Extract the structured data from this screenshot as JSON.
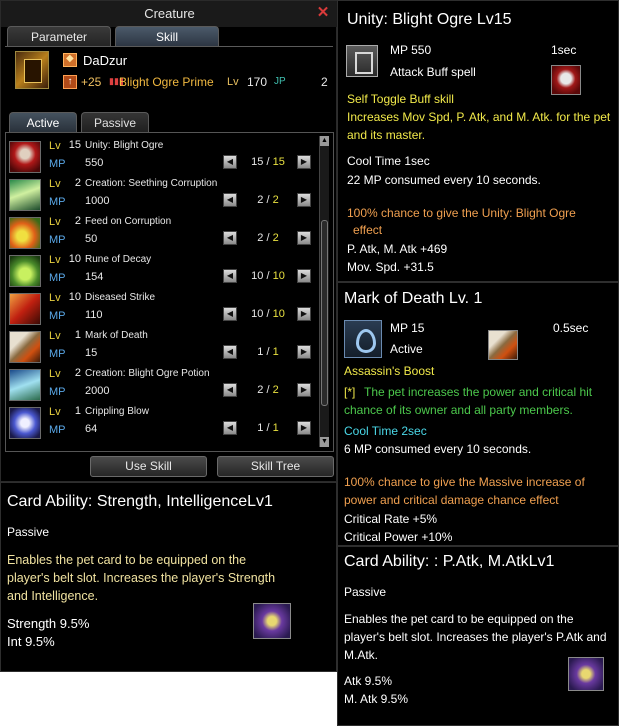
{
  "creature_window": {
    "title": "Creature",
    "close_symbol": "✕",
    "tabs": [
      {
        "label": "Parameter"
      },
      {
        "label": "Skill"
      }
    ],
    "pet": {
      "name": "DaDzur",
      "rank_plus": "+25",
      "species": "Blight Ogre Prime",
      "level_label": "Lv",
      "level": "170",
      "jp_label": "JP",
      "jp": "2"
    },
    "subtabs": [
      {
        "label": "Active"
      },
      {
        "label": "Passive"
      }
    ],
    "skill_level_label": "Lv",
    "skill_mp_label": "MP",
    "skills": [
      {
        "name": "Unity: Blight Ogre",
        "level": "15",
        "mp": "550",
        "current": "15",
        "max": "15",
        "icon": "blight-ogre-icon"
      },
      {
        "name": "Creation: Seething Corruption",
        "level": "2",
        "mp": "1000",
        "current": "2",
        "max": "2",
        "icon": "seething-corruption-icon"
      },
      {
        "name": "Feed on Corruption",
        "level": "2",
        "mp": "50",
        "current": "2",
        "max": "2",
        "icon": "feed-corruption-icon"
      },
      {
        "name": "Rune of Decay",
        "level": "10",
        "mp": "154",
        "current": "10",
        "max": "10",
        "icon": "rune-of-decay-icon"
      },
      {
        "name": "Diseased Strike",
        "level": "10",
        "mp": "110",
        "current": "10",
        "max": "10",
        "icon": "diseased-strike-icon"
      },
      {
        "name": "Mark of Death",
        "level": "1",
        "mp": "15",
        "current": "1",
        "max": "1",
        "icon": "mark-of-death-icon"
      },
      {
        "name": "Creation: Blight Ogre Potion",
        "level": "2",
        "mp": "2000",
        "current": "2",
        "max": "2",
        "icon": "ogre-potion-icon"
      },
      {
        "name": "Crippling Blow",
        "level": "1",
        "mp": "64",
        "current": "1",
        "max": "1",
        "icon": "crippling-blow-icon"
      }
    ],
    "buttons": {
      "use_skill": "Use Skill",
      "skill_tree": "Skill Tree"
    }
  },
  "tooltip_unity": {
    "title": "Unity: Blight Ogre Lv15",
    "mp": "MP 550",
    "cast_time": "1sec",
    "spell_type": "Attack Buff spell",
    "kind": "Self Toggle Buff skill",
    "description_line1": "Increases Mov Spd, P. Atk, and M. Atk. for the pet",
    "description_line2": "and its master.",
    "cooltime": "Cool Time 1sec",
    "consumption": "22 MP consumed every 10 seconds.",
    "chance_line1": "100% chance to give the Unity: Blight Ogre",
    "chance_line2": "effect",
    "effect1": "P. Atk, M. Atk +469",
    "effect2": "Mov. Spd. +31.5"
  },
  "tooltip_mark": {
    "title": "Mark of Death Lv. 1",
    "mp": "MP 15",
    "cast_time": "0.5sec",
    "kind": "Active",
    "boost": "Assassin's Boost",
    "marker": "[*]",
    "description_line1": "The pet increases the power and critical hit",
    "description_line2": "chance of its owner and all party members.",
    "cooltime": "Cool Time 2sec",
    "consumption": "6 MP consumed every 10 seconds.",
    "chance_line1": "100% chance to give the Massive increase of",
    "chance_line2": "power and critical damage chance effect",
    "effect1": "Critical Rate +5%",
    "effect2": "Critical Power +10%"
  },
  "tooltip_card1": {
    "title": "Card Ability: Strength, IntelligenceLv1",
    "kind": "Passive",
    "description_line1": "Enables the pet card to be equipped on the",
    "description_line2": "player's belt slot. Increases the player's Strength",
    "description_line3": "and Intelligence.",
    "effect1": "Strength 9.5%",
    "effect2": "Int 9.5%"
  },
  "tooltip_card2": {
    "title": "Card Ability: : P.Atk, M.AtkLv1",
    "kind": "Passive",
    "description_line1": "Enables the pet card to be equipped on the",
    "description_line2": "player's belt slot. Increases the player's P.Atk and",
    "description_line3": "M.Atk.",
    "effect1": "Atk 9.5%",
    "effect2": "M. Atk 9.5%"
  }
}
